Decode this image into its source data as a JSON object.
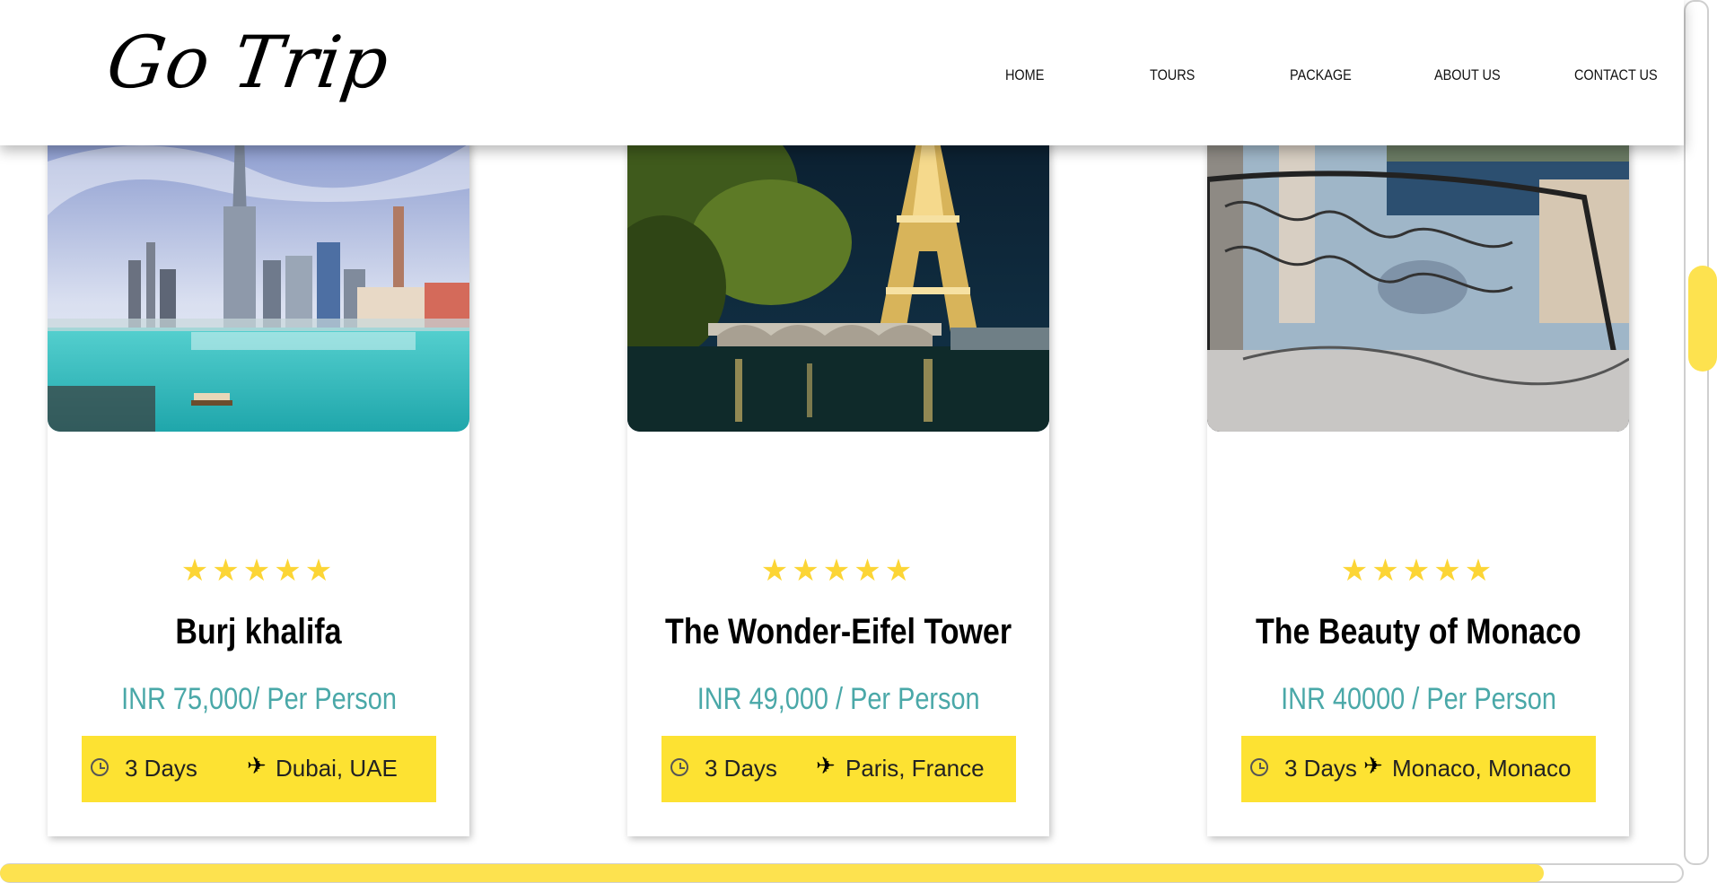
{
  "brand": {
    "logo": "Go Trip"
  },
  "nav": {
    "items": [
      "HOME",
      "TOURS",
      "PACKAGE",
      "ABOUT US",
      "CONTACT US"
    ]
  },
  "colors": {
    "accent": "#fde232",
    "price": "#4aa8a8",
    "star": "#fcd535"
  },
  "cards": [
    {
      "rating": 5,
      "stars": "★★★★★",
      "title": "Burj khalifa",
      "price": "INR 75,000/ Per Person",
      "days": "3 Days",
      "location": "Dubai, UAE",
      "image_icon": "burj-khalifa-photo"
    },
    {
      "rating": 5,
      "stars": "★★★★★",
      "title": "The Wonder-Eifel Tower",
      "price": "INR 49,000 / Per Person",
      "days": "3 Days",
      "location": "Paris, France",
      "image_icon": "eiffel-tower-photo"
    },
    {
      "rating": 5,
      "stars": "★★★★★",
      "title": "The Beauty of Monaco",
      "price": "INR 40000 / Per Person",
      "days": "3 Days",
      "location": "Monaco, Monaco",
      "image_icon": "monaco-photo"
    }
  ],
  "icons": {
    "duration": "clock-icon",
    "destination": "plane-icon",
    "rating": "star-icon"
  }
}
